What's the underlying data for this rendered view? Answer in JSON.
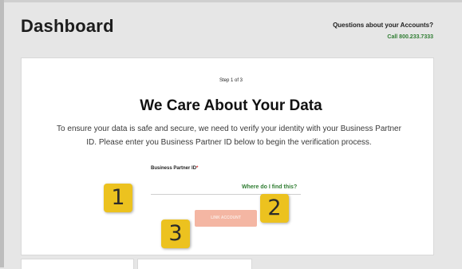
{
  "header": {
    "title": "Dashboard",
    "help_question": "Questions about your Accounts?",
    "help_call": "Call 800.233.7333"
  },
  "verification": {
    "step": "Step 1 of 3",
    "heading": "We Care About Your Data",
    "body_line1": "To ensure your data is safe and secure, we need to verify your identity with your Business Partner",
    "body_line2": "ID. Please enter you Business Partner ID below to begin the verification process.",
    "field_label": "Business Partner ID",
    "required_mark": "*",
    "field_value": "",
    "help_link": "Where do I find this?",
    "submit_label": "LINK ACCOUNT"
  },
  "annotations": [
    "1",
    "2",
    "3"
  ],
  "colors": {
    "accent_green": "#2f7d32",
    "button_disabled": "#f4b6a3",
    "badge": "#ecc21f",
    "background": "#e6e6e6"
  }
}
